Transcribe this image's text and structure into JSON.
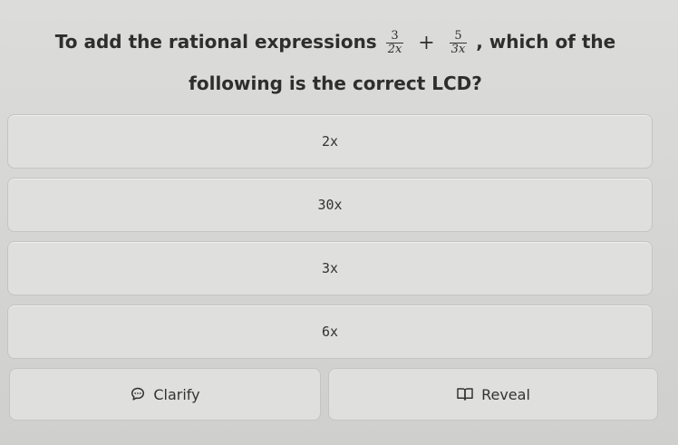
{
  "question": {
    "prefix": "To add the rational expressions",
    "fraction1": {
      "numerator": "3",
      "denominator": "2x"
    },
    "operator": "+",
    "fraction2": {
      "numerator": "5",
      "denominator": "3x"
    },
    "suffix_line1": ", which of the",
    "line2": "following is the correct LCD?"
  },
  "options": [
    {
      "label": "2x"
    },
    {
      "label": "30x"
    },
    {
      "label": "3x"
    },
    {
      "label": "6x"
    }
  ],
  "actions": {
    "clarify_label": "Clarify",
    "clarify_icon": "chat-bubble-icon",
    "reveal_label": "Reveal",
    "reveal_icon": "open-book-icon"
  }
}
